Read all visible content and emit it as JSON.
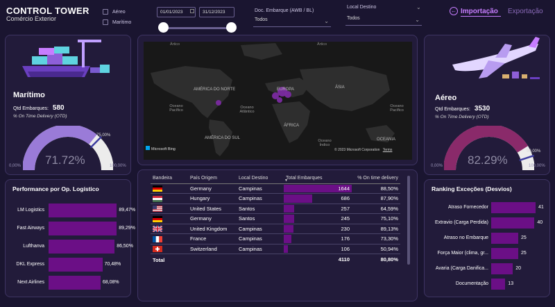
{
  "header": {
    "title": "CONTROL TOWER",
    "subtitle": "Comércio Exterior"
  },
  "filters": {
    "mode_aereo": "Aéreo",
    "mode_maritimo": "Marítimo",
    "date_start": "01/01/2023",
    "date_end": "31/12/2023",
    "doc_label": "Doc. Embarque (AWB / BL)",
    "doc_value": "Todos",
    "local_label": "Local Destino",
    "local_value": "Todos"
  },
  "nav": {
    "import_label": "Importação",
    "export_label": "Exportação"
  },
  "maritimo": {
    "title": "Marítimo",
    "qtd_label": "Qtd Embarques:",
    "qtd_value": "580",
    "otd_label": "% On Time Delivery (OTD)",
    "gauge_value": "71.72%",
    "gauge_fraction": 0.7172,
    "target": "75,00%",
    "target_fraction": 0.75,
    "min": "0,00%",
    "max": "100,00%"
  },
  "aereo": {
    "title": "Aéreo",
    "qtd_label": "Qtd Embarques:",
    "qtd_value": "3530",
    "otd_label": "% On Time Delivery (OTD)",
    "gauge_value": "82.29%",
    "gauge_fraction": 0.8229,
    "target": "90,00%",
    "target_fraction": 0.9,
    "min": "0,00%",
    "max": "100,00%"
  },
  "map": {
    "labels": [
      "Ártico",
      "AMÉRICA DO NORTE",
      "EUROPA",
      "ÁSIA",
      "Oceano Pacífico",
      "Oceano Atlântico",
      "ÁFRICA",
      "Oceano Pacífico",
      "AMÉRICA DO SUL",
      "Oceano Índico",
      "OCEANIA",
      "Ártico"
    ],
    "bing": "Microsoft Bing",
    "copyright": "© 2023 Microsoft Corporation",
    "terms": "Terms"
  },
  "performance": {
    "title": "Performance por Op. Logístico",
    "items": [
      {
        "label": "LM Logistics",
        "value": "89,47%",
        "fraction": 0.8947
      },
      {
        "label": "Fast Airways",
        "value": "89,29%",
        "fraction": 0.8929
      },
      {
        "label": "Lufthanva",
        "value": "86,50%",
        "fraction": 0.865
      },
      {
        "label": "DKL Express",
        "value": "70,48%",
        "fraction": 0.7048
      },
      {
        "label": "Next Airlines",
        "value": "68,08%",
        "fraction": 0.6808
      }
    ]
  },
  "table": {
    "headers": [
      "Bandeira",
      "País Origem",
      "Local Destino",
      "Total Embarques",
      "% On time delivery"
    ],
    "rows": [
      {
        "flag": "germany-flag",
        "pais": "Germany",
        "local": "Campinas",
        "total": "1644",
        "total_num": 1644,
        "otd": "88,50%"
      },
      {
        "flag": "hungary-flag",
        "pais": "Hungary",
        "local": "Campinas",
        "total": "686",
        "total_num": 686,
        "otd": "87,90%"
      },
      {
        "flag": "usa-flag",
        "pais": "United States",
        "local": "Santos",
        "total": "257",
        "total_num": 257,
        "otd": "64,59%"
      },
      {
        "flag": "germany-flag",
        "pais": "Germany",
        "local": "Santos",
        "total": "245",
        "total_num": 245,
        "otd": "75,10%"
      },
      {
        "flag": "uk-flag",
        "pais": "United Kingdom",
        "local": "Campinas",
        "total": "230",
        "total_num": 230,
        "otd": "89,13%"
      },
      {
        "flag": "france-flag",
        "pais": "France",
        "local": "Campinas",
        "total": "176",
        "total_num": 176,
        "otd": "73,30%"
      },
      {
        "flag": "switzerland-flag",
        "pais": "Switzerland",
        "local": "Campinas",
        "total": "106",
        "total_num": 106,
        "otd": "50,94%"
      }
    ],
    "total_label": "Total",
    "total_value": "4110",
    "total_otd": "80,80%"
  },
  "ranking": {
    "title": "Ranking Exceções (Desvios)",
    "items": [
      {
        "label": "Atraso Fornecedor",
        "value": "41",
        "num": 41
      },
      {
        "label": "Extravio (Carga Perdida)",
        "value": "40",
        "num": 40
      },
      {
        "label": "Atraso no Embarque",
        "value": "25",
        "num": 25
      },
      {
        "label": "Força Maior (clima, gr...",
        "value": "25",
        "num": 25
      },
      {
        "label": "Avaria (Carga Danifica...",
        "value": "20",
        "num": 20
      },
      {
        "label": "Documentação",
        "value": "13",
        "num": 13
      }
    ]
  },
  "colors": {
    "bg": "#1a1530",
    "panel": "#221b3a",
    "accent": "#c77dff",
    "bar": "#6b0f86",
    "gauge_maritimo": "#9a7bd8",
    "gauge_aereo": "#8a2a6a"
  }
}
